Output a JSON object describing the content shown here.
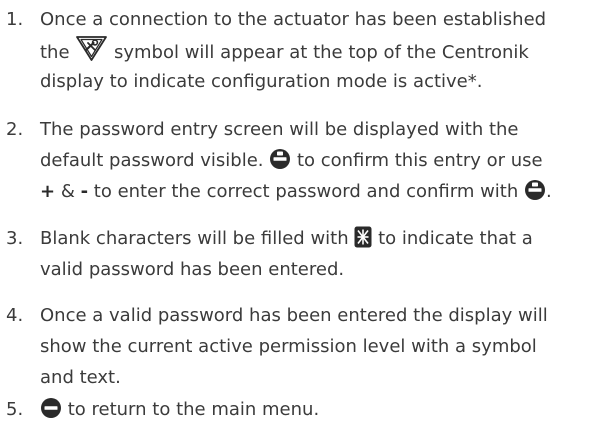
{
  "steps": [
    {
      "number": "1.",
      "lines": [
        [
          "Once a connection to the actuator has been established"
        ],
        [
          "the ",
          {
            "icon": "wrench-triangle-icon"
          },
          " symbol will appear at the top of the Centronik"
        ],
        [
          "display to indicate configuration mode is active*."
        ]
      ]
    },
    {
      "number": "2.",
      "lines": [
        [
          "The password entry screen will be displayed with the"
        ],
        [
          "default password visible. ",
          {
            "icon": "confirm-knob-icon"
          },
          " to confirm this entry or use"
        ],
        [
          {
            "bold": "+"
          },
          " & ",
          {
            "bold": "-"
          },
          " to enter the correct password and confirm with ",
          {
            "icon": "confirm-knob-icon"
          },
          "."
        ]
      ]
    },
    {
      "number": "3.",
      "lines": [
        [
          "Blank characters will be filled with ",
          {
            "icon": "filled-character-icon"
          },
          " to indicate that a"
        ],
        [
          "valid password has been entered."
        ]
      ]
    },
    {
      "number": "4.",
      "lines": [
        [
          "Once a valid password has been entered the display will"
        ],
        [
          "show the current active permission level with a symbol"
        ],
        [
          "and text."
        ]
      ]
    },
    {
      "number": "5.",
      "lines": [
        [
          {
            "icon": "back-knob-icon"
          },
          " to return to the main menu."
        ]
      ]
    }
  ]
}
